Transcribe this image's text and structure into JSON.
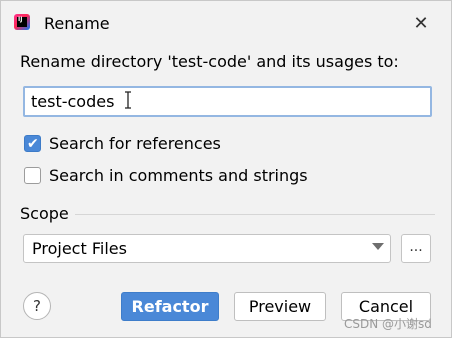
{
  "window": {
    "app_icon": "intellij-idea-icon",
    "title": "Rename",
    "close_symbol": "✕"
  },
  "prompt": "Rename directory 'test-code' and its usages to:",
  "name_input": {
    "value": "test-codes"
  },
  "options": [
    {
      "label": "Search for references",
      "checked": true
    },
    {
      "label": "Search in comments and strings",
      "checked": false
    }
  ],
  "scope": {
    "label": "Scope",
    "selected": "Project Files",
    "more_label": "..."
  },
  "help_label": "?",
  "buttons": {
    "refactor": "Refactor",
    "preview": "Preview",
    "cancel": "Cancel"
  },
  "watermark": "CSDN @小谢sd",
  "colors": {
    "accent": "#4a88d7",
    "input_focus_border": "#94b7e2",
    "background": "#f2f2f2"
  }
}
